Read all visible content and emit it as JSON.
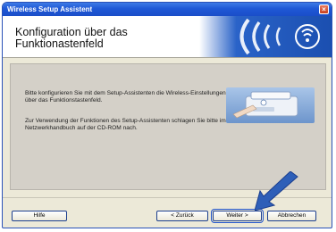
{
  "window": {
    "title": "Wireless Setup Assistent",
    "close_glyph": "×"
  },
  "banner": {
    "heading_line1": "Konfiguration über das",
    "heading_line2": "Funktionastenfeld"
  },
  "content": {
    "paragraph1": "Bitte konfigurieren Sie mit dem Setup-Assistenten die Wireless-Einstellungen über das Funktionstastenfeld.",
    "paragraph2": "Zur Verwendung der Funktionen des Setup-Assistenten schlagen Sie bitte im Netzwerkhandbuch auf der CD-ROM nach."
  },
  "buttons": {
    "help": "Hilfe",
    "back": "< Zurück",
    "next": "Weiter >",
    "cancel": "Abbrechen"
  },
  "colors": {
    "titlebar": "#1f58d6",
    "logo_blue": "#1b4fb0",
    "arrow": "#2e5fb8"
  },
  "icons": {
    "logo": "wireless-signal-icon",
    "device": "printer-device-icon",
    "pointer": "pointer-arrow-icon"
  }
}
